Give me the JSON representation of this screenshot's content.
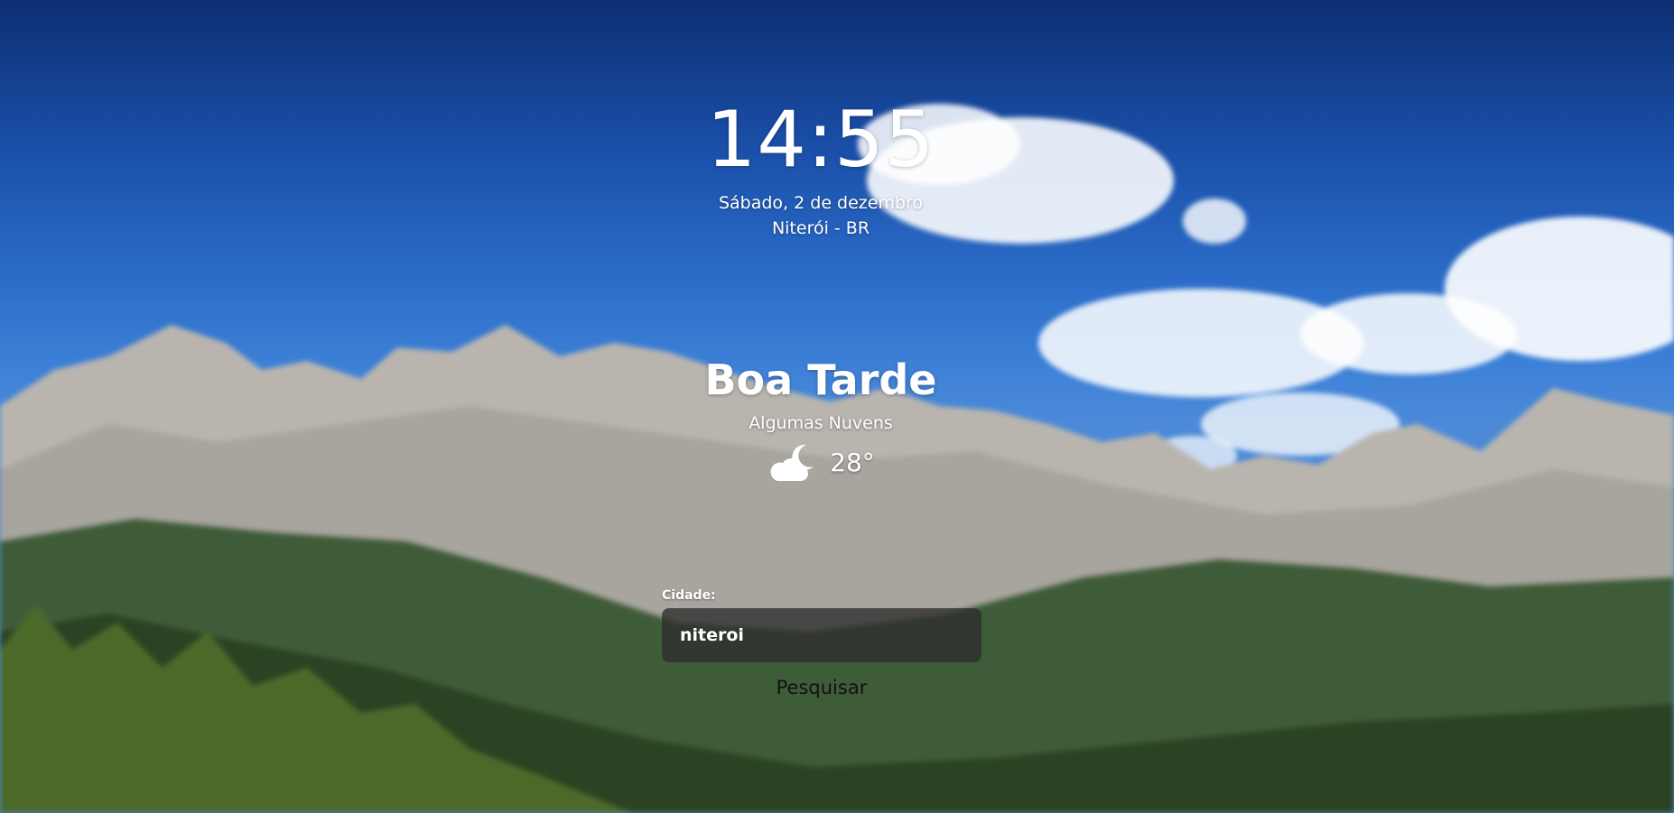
{
  "clock": {
    "time": "14:55"
  },
  "date": {
    "text": "Sábado, 2 de dezembro"
  },
  "location": {
    "text": "Niterói - BR"
  },
  "greeting": {
    "text": "Boa Tarde"
  },
  "weather": {
    "condition": "Algumas Nuvens",
    "temperature": "28°",
    "icon": "cloud-moon-icon"
  },
  "search": {
    "label": "Cidade:",
    "value": "niteroi",
    "button_label": "Pesquisar"
  },
  "colors": {
    "text": "#ffffff",
    "input_bg": "#2d2d2d",
    "button_text": "#111111"
  }
}
